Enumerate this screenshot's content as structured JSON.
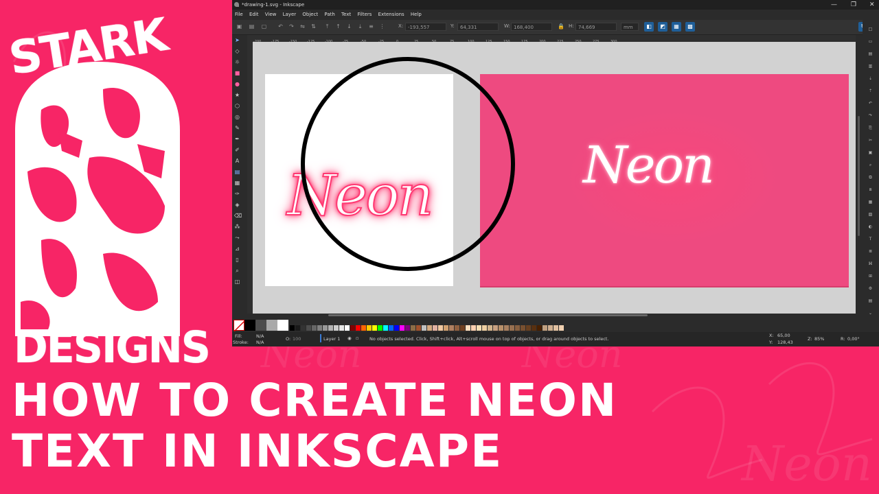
{
  "colors": {
    "background": "#f72566",
    "neon_glow": "#ff2f6a",
    "page_pink": "#ee4a80",
    "accent_blue": "#1f5f99"
  },
  "background_script": [
    "Neon",
    "Neon",
    "Neon"
  ],
  "logo": {
    "top": "STARK",
    "bottom": "DESIGNS"
  },
  "headline": {
    "line1": "HOW TO CREATE NEON",
    "line2": "TEXT IN INKSCAPE"
  },
  "window": {
    "title": "*drawing-1.svg - Inkscape",
    "controls": [
      "—",
      "❐",
      "✕"
    ],
    "menu": [
      "File",
      "Edit",
      "View",
      "Layer",
      "Object",
      "Path",
      "Text",
      "Filters",
      "Extensions",
      "Help"
    ]
  },
  "toolbar": {
    "x_label": "X:",
    "x_value": "-193,557",
    "y_label": "Y:",
    "y_value": "64,331",
    "w_label": "W:",
    "w_value": "168,400",
    "h_label": "H:",
    "h_value": "74,669",
    "unit": "mm"
  },
  "ruler_labels": [
    "-200",
    "-175",
    "-150",
    "-125",
    "-100",
    "-75",
    "-50",
    "-25",
    "0",
    "25",
    "50",
    "75",
    "100",
    "125",
    "150",
    "175",
    "200",
    "225",
    "250",
    "275",
    "300"
  ],
  "canvas": {
    "left_text": "Neon",
    "right_text": "Neon"
  },
  "palette": [
    "#000000",
    "#1a1a1a",
    "#333333",
    "#4d4d4d",
    "#666666",
    "#808080",
    "#999999",
    "#b3b3b3",
    "#cccccc",
    "#e6e6e6",
    "#ffffff",
    "#800000",
    "#ff0000",
    "#ff6600",
    "#ffcc00",
    "#ffff00",
    "#00ff00",
    "#00ffff",
    "#0066ff",
    "#0000ff",
    "#ff00ff",
    "#800080",
    "#8c6d46",
    "#a0522d",
    "#c0c0c0",
    "#d4aa80",
    "#e0b0a0",
    "#f0c8a0",
    "#d0a070",
    "#b08060",
    "#906040",
    "#704020",
    "#ffe0c0",
    "#ffd0b0",
    "#f5deb3",
    "#eecfa1",
    "#d2b48c",
    "#c8a080",
    "#b8906a",
    "#a88060",
    "#987050",
    "#886040",
    "#785030",
    "#684020",
    "#583010",
    "#482000",
    "#c0a080",
    "#d0b090",
    "#e0c0a0",
    "#f0d0b0"
  ],
  "status": {
    "fill_label": "Fill:",
    "fill_value": "N/A",
    "stroke_label": "Stroke:",
    "stroke_value": "N/A",
    "opacity_label": "O:",
    "opacity_value": "100",
    "layer": "Layer 1",
    "message": "No objects selected. Click, Shift+click, Alt+scroll mouse on top of objects, or drag around objects to select.",
    "x_label": "X:",
    "x_coord": "65,00",
    "y_label": "Y:",
    "y_coord": "128,43",
    "zoom_label": "Z:",
    "zoom": "85%",
    "rotation_label": "R:",
    "rotation": "0,00°"
  }
}
